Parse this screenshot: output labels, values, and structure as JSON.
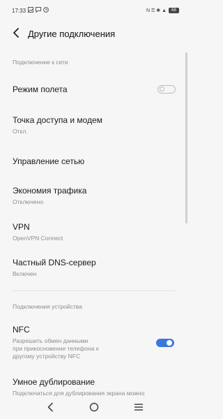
{
  "status_bar": {
    "time": "17:33",
    "left_icons": [
      "image-icon",
      "message-icon",
      "clock-icon"
    ],
    "right_text": "N ⚿ ✱ ▲",
    "battery": "68"
  },
  "header": {
    "back_icon": "back-arrow-icon",
    "title": "Другие подключения"
  },
  "sections": {
    "network": {
      "title": "Подключение к сети",
      "items": [
        {
          "title": "Режим полета",
          "subtitle": "",
          "toggle": "off"
        },
        {
          "title": "Точка доступа и модем",
          "subtitle": "Откл."
        },
        {
          "title": "Управление сетью",
          "subtitle": ""
        },
        {
          "title": "Экономия трафика",
          "subtitle": "Отключено"
        },
        {
          "title": "VPN",
          "subtitle": "OpenVPN Connect"
        },
        {
          "title": "Частный DNS-сервер",
          "subtitle": "Включен"
        }
      ]
    },
    "device": {
      "title": "Подключения устройства",
      "items": [
        {
          "title": "NFC",
          "subtitle_lines": [
            "Разрешить обмен данными",
            "при прикосновении телефона к",
            "другому устройству NFC"
          ],
          "toggle": "on"
        },
        {
          "title": "Умное дублирование",
          "subtitle": "Подключаться для дублирования экрана можно"
        }
      ]
    }
  },
  "colors": {
    "accent": "#3a78e0",
    "background": "#f6f6f6"
  },
  "nav_bar": {
    "icons": [
      "back-triangle-icon",
      "home-circle-icon",
      "menu-lines-icon"
    ]
  }
}
